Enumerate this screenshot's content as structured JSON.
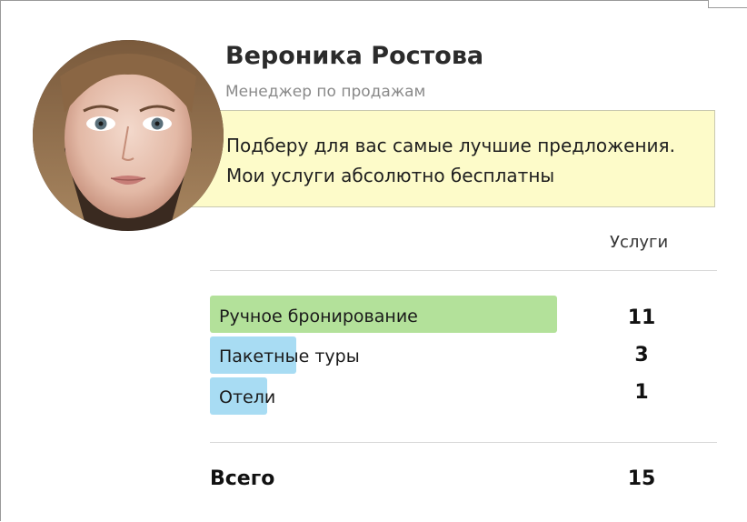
{
  "profile": {
    "name": "Вероника Ростова",
    "role": "Менеджер по продажам",
    "note_line1": "Подберу для вас самые лучшие предложения.",
    "note_line2": "Мои услуги абсолютно бесплатны"
  },
  "services": {
    "header": "Услуги",
    "items": [
      {
        "label": "Ручное бронирование",
        "count": "11",
        "color": "#b3e19a"
      },
      {
        "label": "Пакетные туры",
        "count": "3",
        "color": "#a8dcf3"
      },
      {
        "label": "Отели",
        "count": "1",
        "color": "#a8dcf3"
      }
    ],
    "total_label": "Всего",
    "total_value": "15"
  },
  "colors": {
    "note_background": "#fdfbc9"
  }
}
